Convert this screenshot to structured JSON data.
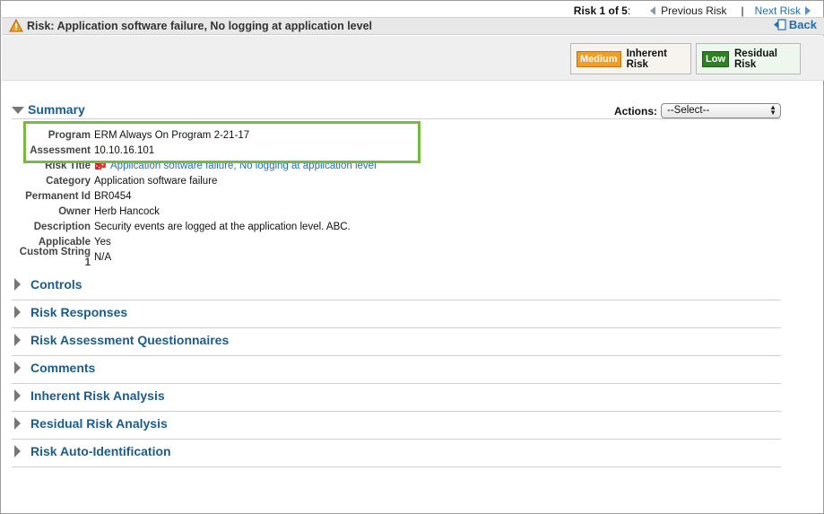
{
  "nav": {
    "counter": "Risk 1 of 5",
    "counter_colon": ":",
    "previous": "Previous Risk",
    "separator": "|",
    "next": "Next Risk"
  },
  "header": {
    "title": "Risk: Application software failure, No logging at application level",
    "back": "Back"
  },
  "risk_badges": {
    "inherent": {
      "level": "Medium",
      "label": "Inherent Risk"
    },
    "residual": {
      "level": "Low",
      "label": "Residual Risk"
    }
  },
  "summary": {
    "heading": "Summary",
    "actions_label": "Actions:",
    "actions_select": "--Select--",
    "fields": [
      {
        "label": "Program",
        "value": "ERM Always On Program 2-21-17"
      },
      {
        "label": "Assessment",
        "value": "10.10.16.101"
      },
      {
        "label": "Risk Title",
        "value": "Application software failure, No logging at application level"
      },
      {
        "label": "Category",
        "value": "Application software failure"
      },
      {
        "label": "Permanent Id",
        "value": "BR0454"
      },
      {
        "label": "Owner",
        "value": "Herb Hancock"
      },
      {
        "label": "Description",
        "value": "Security events are logged at the application level. ABC."
      },
      {
        "label": "Applicable",
        "value": "Yes"
      },
      {
        "label": "Custom String 1",
        "value": "N/A"
      }
    ]
  },
  "sections": [
    "Controls",
    "Risk Responses",
    "Risk Assessment Questionnaires",
    "Comments",
    "Inherent Risk Analysis",
    "Residual Risk Analysis",
    "Risk Auto-Identification"
  ],
  "colors": {
    "link": "#1f6fb2",
    "heading": "#1a5d8c",
    "medium": "#f09e25",
    "low": "#2f7f25",
    "highlight": "#77b943"
  }
}
